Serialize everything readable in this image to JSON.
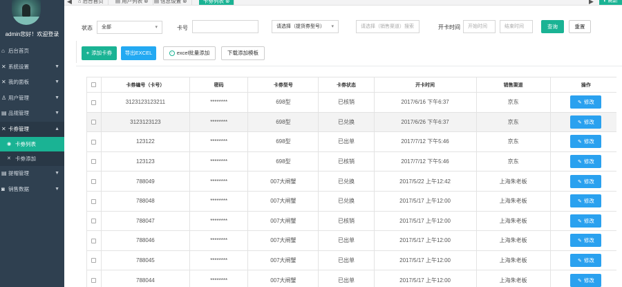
{
  "sidebar": {
    "user_greeting": "admin您好！欢迎登录",
    "menu": [
      {
        "icon": "home-icon",
        "glyph": "⌂",
        "label": "后台首页",
        "caret": ""
      },
      {
        "icon": "tools-icon",
        "glyph": "✕",
        "label": "系统设置",
        "caret": "▼"
      },
      {
        "icon": "panel-icon",
        "glyph": "✕",
        "label": "我的面板",
        "caret": "▼"
      },
      {
        "icon": "user-icon",
        "glyph": "♙",
        "label": "用户管理",
        "caret": "▼"
      },
      {
        "icon": "product-icon",
        "glyph": "▤",
        "label": "品规管理",
        "caret": "▼"
      },
      {
        "icon": "card-icon",
        "glyph": "✕",
        "label": "卡券管理",
        "caret": "▲"
      }
    ],
    "submenu": [
      {
        "label": "卡劵列表",
        "glyph": "◉"
      },
      {
        "label": "卡劵添加",
        "glyph": "✕"
      }
    ],
    "menu_after": [
      {
        "icon": "withdraw-icon",
        "glyph": "▤",
        "label": "提帽管理",
        "caret": "▼"
      },
      {
        "icon": "sales-icon",
        "glyph": "◙",
        "label": "销售数据",
        "caret": "▼"
      }
    ]
  },
  "tabs": {
    "back": "◀",
    "forward": "▶",
    "items": [
      {
        "label": "⌂ 后台首页"
      },
      {
        "label": "▤ 用户列表 ⊗"
      },
      {
        "label": "▤ 信息设置 ⊗"
      },
      {
        "label": "卡劵列表 ⊗",
        "active": true
      }
    ],
    "refresh": "◐ 刷新"
  },
  "filter": {
    "status_label": "状态",
    "status_value": "全部",
    "card_label": "卡号",
    "card_value": "",
    "type_value": "请选择（提货券型号）",
    "channel_placeholder": "请选择（销售渠道）搜索",
    "open_time_label": "开卡时间",
    "start_placeholder": "开始时间",
    "end_placeholder": "结束时间",
    "query_label": "查询",
    "reset_label": "重置"
  },
  "actions": {
    "add_label": "添加卡券",
    "export_label": "导出EXCEL",
    "batch_label": "excel批量添加",
    "template_label": "下载添加模板"
  },
  "table": {
    "columns": [
      "卡劵编号（卡号）",
      "密码",
      "卡劵型号",
      "卡劵状态",
      "开卡时间",
      "销售渠道",
      "操作"
    ],
    "edit_label": "修改",
    "rows": [
      {
        "no": "3123123123211",
        "pwd": "********",
        "model": "698型",
        "status": "已核销",
        "time": "2017/6/16 下午6:37",
        "channel": "京东"
      },
      {
        "no": "3123123123",
        "pwd": "********",
        "model": "698型",
        "status": "已兑换",
        "time": "2017/6/26 下午6:37",
        "channel": "京东"
      },
      {
        "no": "123122",
        "pwd": "********",
        "model": "698型",
        "status": "已出单",
        "time": "2017/7/12 下午5:46",
        "channel": "京东"
      },
      {
        "no": "123123",
        "pwd": "********",
        "model": "698型",
        "status": "已核销",
        "time": "2017/7/12 下午5:46",
        "channel": "京东"
      },
      {
        "no": "788049",
        "pwd": "********",
        "model": "007大闸蟹",
        "status": "已兑换",
        "time": "2017/5/22 上午12:42",
        "channel": "上海朱老板"
      },
      {
        "no": "788048",
        "pwd": "********",
        "model": "007大闸蟹",
        "status": "已兑换",
        "time": "2017/5/17 上午12:00",
        "channel": "上海朱老板"
      },
      {
        "no": "788047",
        "pwd": "********",
        "model": "007大闸蟹",
        "status": "已核销",
        "time": "2017/5/17 上午12:00",
        "channel": "上海朱老板"
      },
      {
        "no": "788046",
        "pwd": "********",
        "model": "007大闸蟹",
        "status": "已出单",
        "time": "2017/5/17 上午12:00",
        "channel": "上海朱老板"
      },
      {
        "no": "788045",
        "pwd": "********",
        "model": "007大闸蟹",
        "status": "已出单",
        "time": "2017/5/17 上午12:00",
        "channel": "上海朱老板"
      },
      {
        "no": "788044",
        "pwd": "********",
        "model": "007大闸蟹",
        "status": "已出单",
        "time": "2017/5/17 上午12:00",
        "channel": "上海朱老板"
      }
    ]
  }
}
